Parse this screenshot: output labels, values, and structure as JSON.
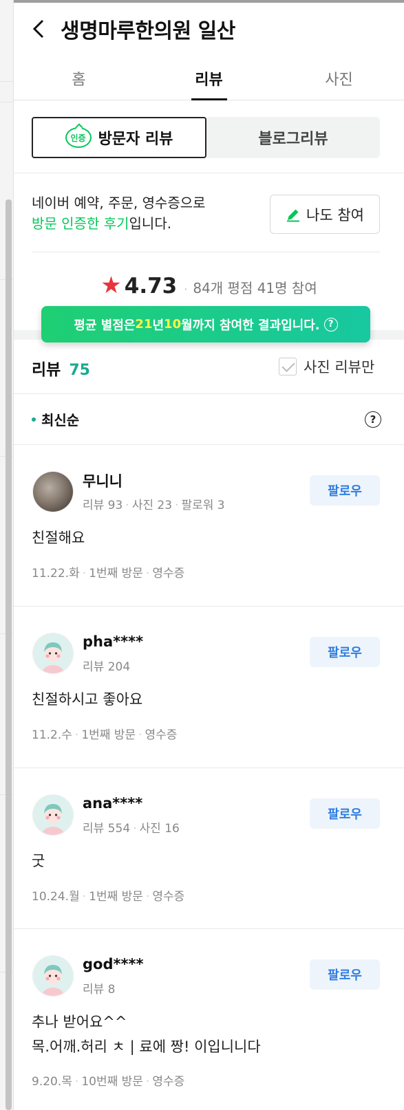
{
  "header": {
    "title": "생명마루한의원 일산"
  },
  "tabs": [
    {
      "label": "홈"
    },
    {
      "label": "리뷰"
    },
    {
      "label": "사진"
    }
  ],
  "segments": {
    "visitor_badge": "인증",
    "visitor": "방문자 리뷰",
    "blog": "블로그리뷰"
  },
  "notice": {
    "line1": "네이버 예약, 주문, 영수증으로",
    "highlight": "방문 인증한 후기",
    "suffix": "입니다.",
    "join_label": "나도 참여"
  },
  "rating": {
    "score": "4.73",
    "meta": "84개 평점 41명 참여"
  },
  "tooltip": {
    "prefix": "평균 별점은 ",
    "year": "21",
    "year_suffix": "년 ",
    "month": "10",
    "month_suffix": "월",
    "rest": "까지 참여한 결과입니다.",
    "help": "?"
  },
  "reviews_header": {
    "label": "리뷰",
    "count": "75",
    "photo_only": "사진 리뷰만",
    "sort": "최신순",
    "help": "?"
  },
  "reviews": [
    {
      "name": "무니니",
      "stats": [
        "리뷰 93",
        "사진 23",
        "팔로워 3"
      ],
      "follow": "팔로우",
      "text": [
        "친절해요"
      ],
      "meta": [
        "11.22.화",
        "1번째 방문",
        "영수증"
      ]
    },
    {
      "name": "pha****",
      "stats": [
        "리뷰 204"
      ],
      "follow": "팔로우",
      "text": [
        "친절하시고 좋아요"
      ],
      "meta": [
        "11.2.수",
        "1번째 방문",
        "영수증"
      ]
    },
    {
      "name": "ana****",
      "stats": [
        "리뷰 554",
        "사진 16"
      ],
      "follow": "팔로우",
      "text": [
        "굿"
      ],
      "meta": [
        "10.24.월",
        "1번째 방문",
        "영수증"
      ]
    },
    {
      "name": "god****",
      "stats": [
        "리뷰 8"
      ],
      "follow": "팔로우",
      "text": [
        "추나 받어요^^",
        "목.어깨.허리 ㅊ | 료에 짱! 이입니니다"
      ],
      "meta": [
        "9.20.목",
        "10번째 방문",
        "영수증"
      ]
    }
  ],
  "colors": {
    "accent_green": "#03c75a",
    "teal": "#1aaa8f",
    "star_red": "#e8343b",
    "follow_blue": "#2d7de0"
  }
}
